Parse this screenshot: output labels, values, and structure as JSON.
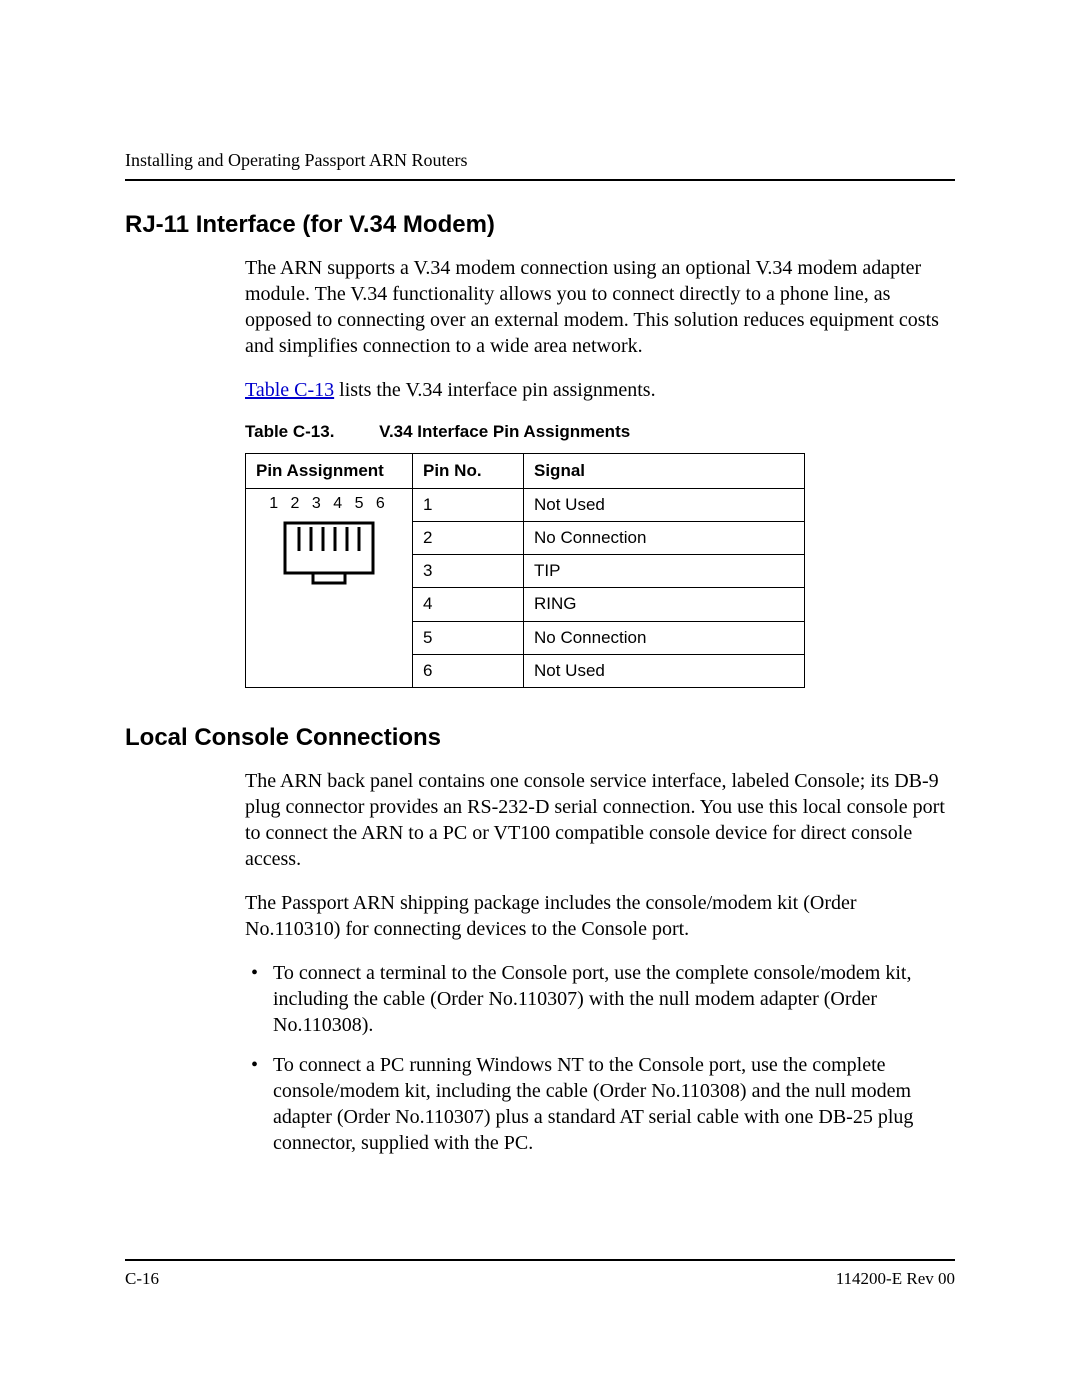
{
  "header": {
    "running": "Installing and Operating Passport ARN Routers"
  },
  "section1": {
    "heading": "RJ-11 Interface (for V.34 Modem)",
    "p1": "The ARN supports a V.34 modem connection using an optional V.34 modem adapter module. The V.34 functionality allows you to connect directly to a phone line, as opposed to connecting over an external modem. This solution reduces equipment costs and simplifies connection to a wide area network.",
    "p2_link": "Table C-13",
    "p2_rest": " lists the V.34 interface pin assignments."
  },
  "table": {
    "caption_id": "Table C-13.",
    "caption_title": "V.34 Interface Pin Assignments",
    "headers": {
      "c1": "Pin Assignment",
      "c2": "Pin No.",
      "c3": "Signal"
    },
    "pin_labels": "1 2 3 4 5 6",
    "rows": [
      {
        "pin": "1",
        "signal": "Not Used"
      },
      {
        "pin": "2",
        "signal": "No Connection"
      },
      {
        "pin": "3",
        "signal": "TIP"
      },
      {
        "pin": "4",
        "signal": "RING"
      },
      {
        "pin": "5",
        "signal": "No Connection"
      },
      {
        "pin": "6",
        "signal": "Not Used"
      }
    ]
  },
  "section2": {
    "heading": "Local Console Connections",
    "p1": "The ARN back panel contains one console service interface, labeled Console; its DB-9 plug connector provides an RS-232-D serial connection. You use this local console port to connect the ARN to a PC or VT100 compatible console device for direct console access.",
    "p2": "The Passport ARN shipping package includes the console/modem kit (Order No.110310) for connecting devices to the Console port.",
    "bullets": [
      "To connect a terminal to the Console port, use the complete console/modem kit, including the cable (Order No.110307) with the null modem adapter (Order No.110308).",
      "To connect a PC running Windows NT to the Console port, use the complete console/modem kit, including the cable (Order No.110308) and the null modem adapter (Order No.110307) plus a standard AT serial cable with one DB-25 plug connector, supplied with the PC."
    ]
  },
  "footer": {
    "left": "C-16",
    "right": "114200-E Rev 00"
  }
}
